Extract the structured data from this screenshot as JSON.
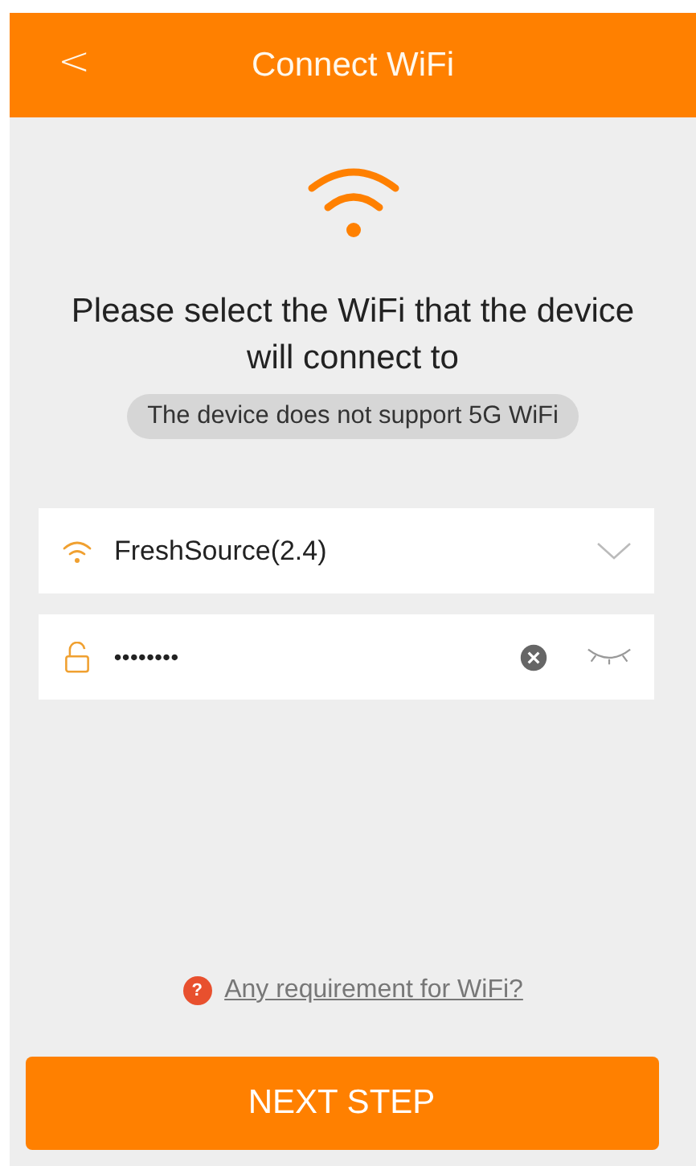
{
  "header": {
    "back": "<",
    "title": "Connect WiFi"
  },
  "heading": "Please select the WiFi that the device will connect to",
  "notice": "The device does not support 5G WiFi",
  "network_field": {
    "value": "FreshSource(2.4)"
  },
  "password_field": {
    "value": "••••••••",
    "revealed": false
  },
  "help_link": {
    "icon": "?",
    "text": "Any requirement for WiFi?"
  },
  "next_button": "NEXT STEP"
}
